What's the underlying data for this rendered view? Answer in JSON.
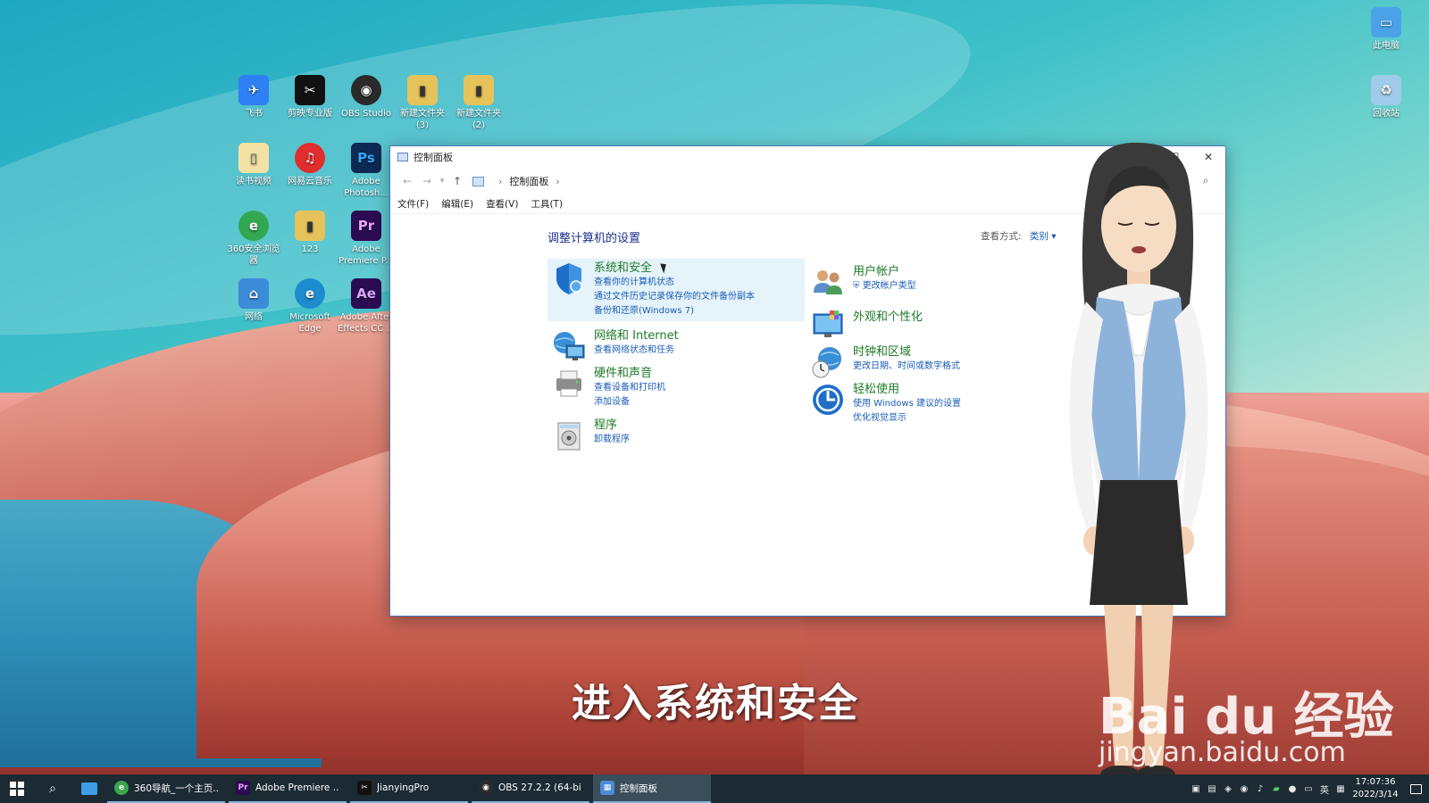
{
  "desktop": {
    "icons": [
      {
        "label": "飞书",
        "color": "#2f7ff5",
        "glyph": "✈"
      },
      {
        "label": "剪映专业版",
        "color": "#111111",
        "glyph": "✂"
      },
      {
        "label": "OBS Studio",
        "color": "#2a2a2a",
        "glyph": "◉"
      },
      {
        "label": "新建文件夹 (3)",
        "color": "#e6c25a",
        "glyph": "▮"
      },
      {
        "label": "新建文件夹 (2)",
        "color": "#e6c25a",
        "glyph": "▮"
      },
      {
        "label": "读书视频",
        "color": "#f3e2a4",
        "glyph": "▯"
      },
      {
        "label": "网易云音乐",
        "color": "#e02e2e",
        "glyph": "♫"
      },
      {
        "label": "Adobe Photosh...",
        "color": "#0d2a55",
        "glyph": "Ps"
      },
      {
        "label": "360安全浏览器",
        "color": "#32a852",
        "glyph": "e"
      },
      {
        "label": "123",
        "color": "#e6c25a",
        "glyph": "▮"
      },
      {
        "label": "Adobe Premiere P...",
        "color": "#2b0c52",
        "glyph": "Pr"
      },
      {
        "label": "网络",
        "color": "#3c8bd9",
        "glyph": "⌂"
      },
      {
        "label": "Microsoft Edge",
        "color": "#1c8ccf",
        "glyph": "e"
      },
      {
        "label": "Adobe After Effects CC ...",
        "color": "#2b0c52",
        "glyph": "Ae"
      },
      {
        "label": "此电脑",
        "color": "#4aa3e8",
        "glyph": "▭"
      },
      {
        "label": "回收站",
        "color": "#9fcbe8",
        "glyph": "♻"
      }
    ]
  },
  "window": {
    "title": "控制面板",
    "address": {
      "root": "控制面板"
    },
    "menu": [
      "文件(F)",
      "编辑(E)",
      "查看(V)",
      "工具(T)"
    ],
    "heading": "调整计算机的设置",
    "view_by_label": "查看方式:",
    "view_by_value": "类别 ▾",
    "categories": [
      {
        "title": "系统和安全",
        "links": [
          "查看你的计算机状态",
          "通过文件历史记录保存你的文件备份副本",
          "备份和还原(Windows 7)"
        ]
      },
      {
        "title": "网络和 Internet",
        "links": [
          "查看网络状态和任务"
        ]
      },
      {
        "title": "硬件和声音",
        "links": [
          "查看设备和打印机",
          "添加设备"
        ]
      },
      {
        "title": "程序",
        "links": [
          "卸载程序"
        ]
      },
      {
        "title": "用户帐户",
        "links": [
          "更改帐户类型"
        ]
      },
      {
        "title": "外观和个性化",
        "links": []
      },
      {
        "title": "时钟和区域",
        "links": [
          "更改日期、时间或数字格式"
        ]
      },
      {
        "title": "轻松使用",
        "links": [
          "使用 Windows 建议的设置",
          "优化视觉显示"
        ]
      }
    ]
  },
  "subtitle": "进入系统和安全",
  "watermark": {
    "logo": "Bai du 经验",
    "url": "jingyan.baidu.com"
  },
  "taskbar": {
    "apps": [
      {
        "label": "360导航_一个主页...",
        "color": "#3aa74b",
        "glyph": "e"
      },
      {
        "label": "Adobe Premiere ...",
        "color": "#2b0c52",
        "glyph": "Pr"
      },
      {
        "label": "JianyingPro",
        "color": "#111111",
        "glyph": "✂"
      },
      {
        "label": "OBS 27.2.2 (64-bi...",
        "color": "#2a2a2a",
        "glyph": "◉"
      },
      {
        "label": "控制面板",
        "color": "#4a8bd6",
        "glyph": "▦"
      }
    ],
    "ime": "英",
    "time": "17:07:36",
    "date": "2022/3/14"
  }
}
